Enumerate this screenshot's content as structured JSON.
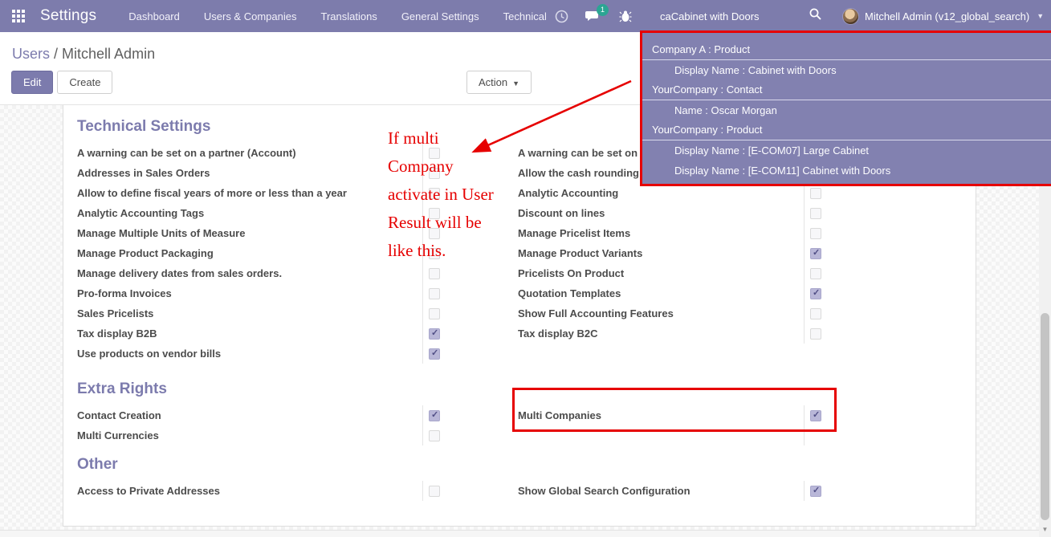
{
  "colors": {
    "accent": "#7c7bad",
    "annotation_red": "#e60000",
    "badge_green": "#2ba593",
    "checked_fill": "#b9b7d8"
  },
  "navbar": {
    "app_title": "Settings",
    "menu": [
      "Dashboard",
      "Users & Companies",
      "Translations",
      "General Settings",
      "Technical"
    ],
    "chat_badge": "1",
    "search_value": "caCabinet with Doors",
    "user_name": "Mitchell Admin (v12_global_search)"
  },
  "search_dropdown": {
    "groups": [
      {
        "header": "Company A : Product",
        "items": [
          "Display Name : Cabinet with Doors"
        ]
      },
      {
        "header": "YourCompany : Contact",
        "items": [
          "Name : Oscar Morgan"
        ]
      },
      {
        "header": "YourCompany : Product",
        "items": [
          "Display Name : [E-COM07] Large Cabinet",
          "Display Name : [E-COM11] Cabinet with Doors"
        ]
      }
    ]
  },
  "breadcrumb": {
    "parent": "Users",
    "separator": " / ",
    "current": "Mitchell Admin"
  },
  "buttons": {
    "edit": "Edit",
    "create": "Create",
    "action": "Action"
  },
  "annotation": {
    "lines": [
      "If multi",
      "Company",
      "activate in User",
      "Result will be",
      "like this."
    ]
  },
  "sections": [
    {
      "title": "Technical Settings",
      "left": [
        {
          "label": "A warning can be set on a partner (Account)",
          "checked": false
        },
        {
          "label": "Addresses in Sales Orders",
          "checked": false
        },
        {
          "label": "Allow to define fiscal years of more or less than a year",
          "checked": false
        },
        {
          "label": "Analytic Accounting Tags",
          "checked": false
        },
        {
          "label": "Manage Multiple Units of Measure",
          "checked": false
        },
        {
          "label": "Manage Product Packaging",
          "checked": false
        },
        {
          "label": "Manage delivery dates from sales orders.",
          "checked": false
        },
        {
          "label": "Pro-forma Invoices",
          "checked": false
        },
        {
          "label": "Sales Pricelists",
          "checked": false
        },
        {
          "label": "Tax display B2B",
          "checked": true
        },
        {
          "label": "Use products on vendor bills",
          "checked": true
        }
      ],
      "right": [
        {
          "label": "A warning can be set on a",
          "checked": false
        },
        {
          "label": "Allow the cash rounding r",
          "checked": false
        },
        {
          "label": "Analytic Accounting",
          "checked": false
        },
        {
          "label": "Discount on lines",
          "checked": false
        },
        {
          "label": "Manage Pricelist Items",
          "checked": false
        },
        {
          "label": "Manage Product Variants",
          "checked": true
        },
        {
          "label": "Pricelists On Product",
          "checked": false
        },
        {
          "label": "Quotation Templates",
          "checked": true
        },
        {
          "label": "Show Full Accounting Features",
          "checked": false
        },
        {
          "label": "Tax display B2C",
          "checked": false
        }
      ]
    },
    {
      "title": "Extra Rights",
      "left": [
        {
          "label": "Contact Creation",
          "checked": true
        },
        {
          "label": "Multi Currencies",
          "checked": false
        }
      ],
      "right": [
        {
          "label": "Multi Companies",
          "checked": true
        },
        {
          "label": "",
          "empty": true
        }
      ]
    },
    {
      "title": "Other",
      "left": [
        {
          "label": "Access to Private Addresses",
          "checked": false
        }
      ],
      "right": [
        {
          "label": "Show Global Search Configuration",
          "checked": true
        }
      ]
    }
  ]
}
